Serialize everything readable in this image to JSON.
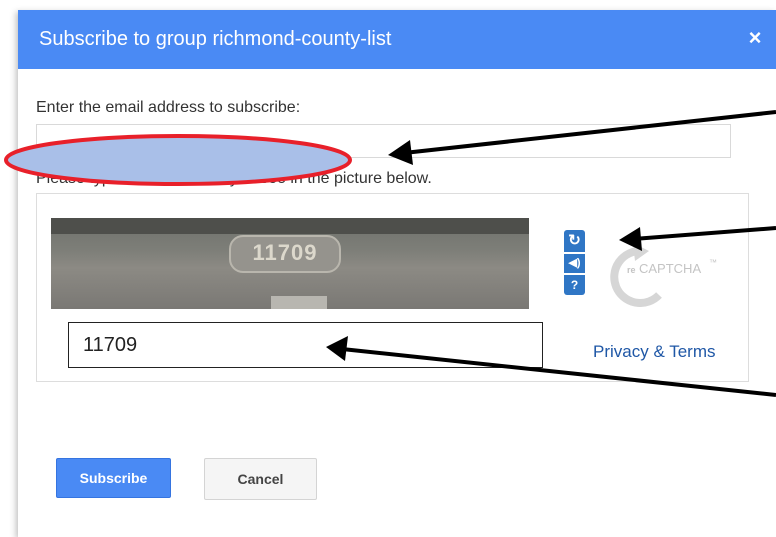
{
  "dialog": {
    "title": "Subscribe to group richmond-county-list",
    "close_label": "×"
  },
  "email": {
    "label": "Enter the email address to subscribe:",
    "value": "",
    "placeholder": ""
  },
  "captcha": {
    "prompt": "Please type the characters you see in the picture below.",
    "image_text": "11709",
    "answer_value": "11709",
    "reload_icon": "reload-icon",
    "audio_icon": "audio-icon",
    "help_icon": "help-icon",
    "logo_prefix": "re",
    "logo_text": "CAPTCHA",
    "logo_tm": "™",
    "privacy_label": "Privacy & Terms"
  },
  "actions": {
    "subscribe_label": "Subscribe",
    "cancel_label": "Cancel"
  },
  "annotations": {
    "highlight_color": "#e8202a",
    "highlight_fill": "#a9bfe8",
    "arrow_color": "#000000"
  },
  "colors": {
    "header": "#4a8af4",
    "link": "#1f57a6",
    "captcha_button": "#2f76c5"
  }
}
